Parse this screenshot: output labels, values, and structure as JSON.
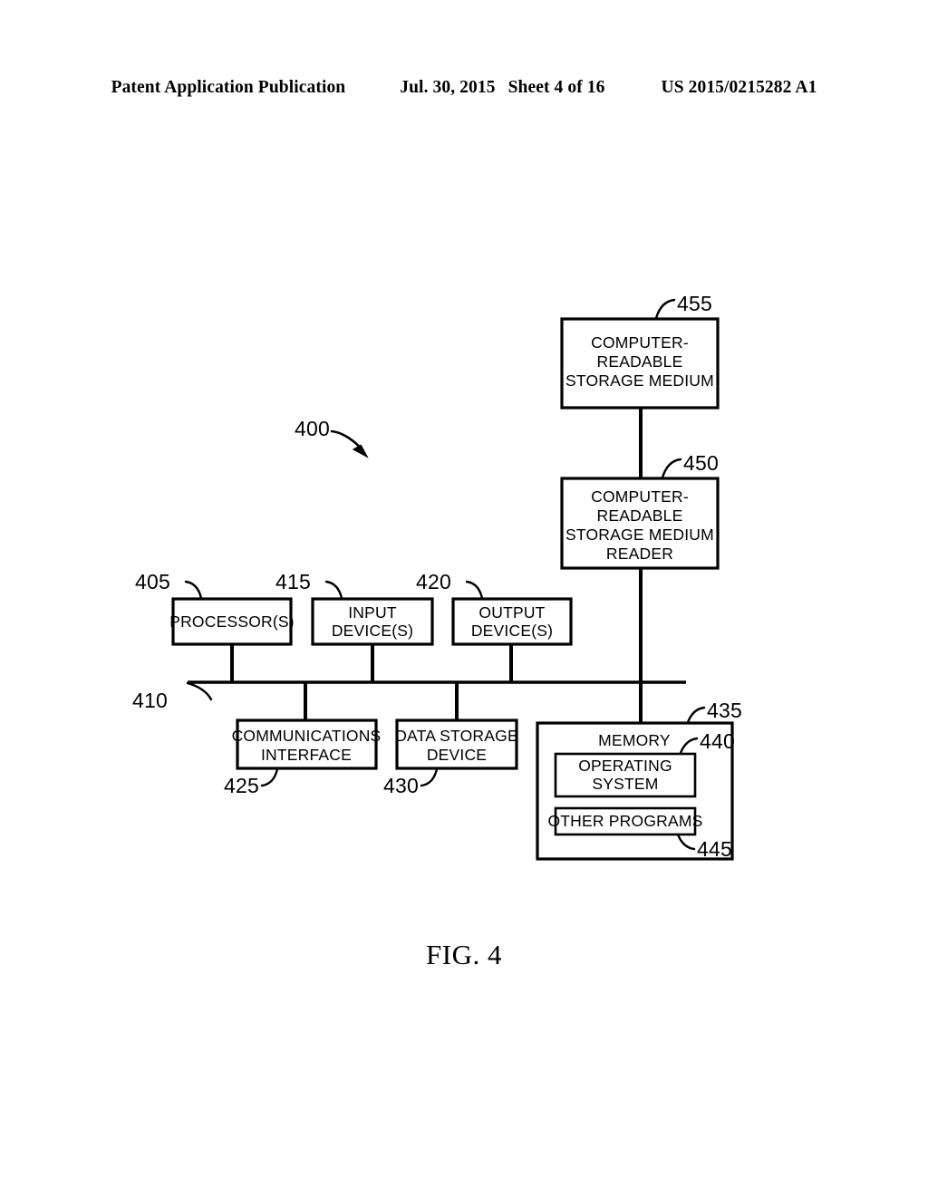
{
  "header": {
    "title": "Patent Application Publication",
    "date": "Jul. 30, 2015",
    "sheet": "Sheet 4 of 16",
    "number": "US 2015/0215282 A1"
  },
  "figure": {
    "caption": "FIG. 4",
    "system_ref": "400"
  },
  "blocks": {
    "crsm": {
      "ref": "455",
      "lines": [
        "COMPUTER-",
        "READABLE",
        "STORAGE MEDIUM"
      ]
    },
    "crsm_reader": {
      "ref": "450",
      "lines": [
        "COMPUTER-",
        "READABLE",
        "STORAGE MEDIUM",
        "READER"
      ]
    },
    "processor": {
      "ref": "405",
      "lines": [
        "PROCESSOR(S)"
      ]
    },
    "input_device": {
      "ref": "415",
      "lines": [
        "INPUT",
        "DEVICE(S)"
      ]
    },
    "output_device": {
      "ref": "420",
      "lines": [
        "OUTPUT",
        "DEVICE(S)"
      ]
    },
    "bus": {
      "ref": "410"
    },
    "comm_interface": {
      "ref": "425",
      "lines": [
        "COMMUNICATIONS",
        "INTERFACE"
      ]
    },
    "data_storage": {
      "ref": "430",
      "lines": [
        "DATA STORAGE",
        "DEVICE"
      ]
    },
    "memory": {
      "ref": "435",
      "lines": [
        "MEMORY"
      ]
    },
    "operating_system": {
      "ref": "440",
      "lines": [
        "OPERATING",
        "SYSTEM"
      ]
    },
    "other_programs": {
      "ref": "445",
      "lines": [
        "OTHER PROGRAMS"
      ]
    }
  },
  "colors": {
    "ink": "#000000",
    "paper": "#ffffff"
  }
}
